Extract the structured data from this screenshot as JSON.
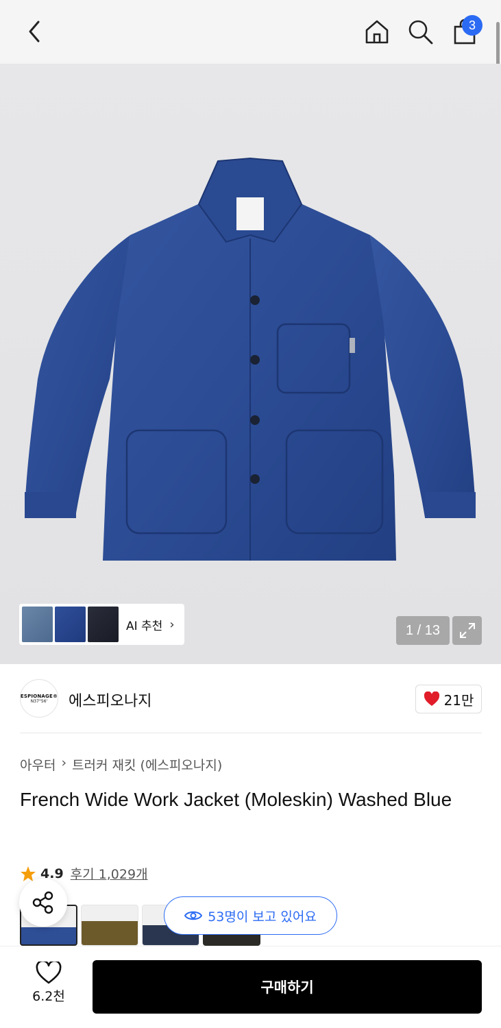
{
  "topbar": {
    "cart_count": "3"
  },
  "gallery": {
    "ai_recommend_label": "AI 추천",
    "counter": "1 / 13"
  },
  "brand": {
    "logo_line1": "ESPIONAGE®",
    "logo_line2": "N37°56'",
    "name": "에스피오나지",
    "likes": "21만"
  },
  "breadcrumb": {
    "category": "아우터",
    "separator": "›",
    "subcategory": "트러커 재킷 (에스피오나지)"
  },
  "product": {
    "title": "French Wide Work Jacket (Moleskin) Washed Blue",
    "rating": "4.9",
    "reviews": "후기 1,029개"
  },
  "viewing": {
    "text": "53명이 보고 있어요"
  },
  "bottom": {
    "wishlist_count": "6.2천",
    "buy_label": "구매하기"
  },
  "colors": {
    "accent_blue": "#2b6bf3",
    "star": "#f59e0b",
    "heart": "#e11d2a"
  }
}
